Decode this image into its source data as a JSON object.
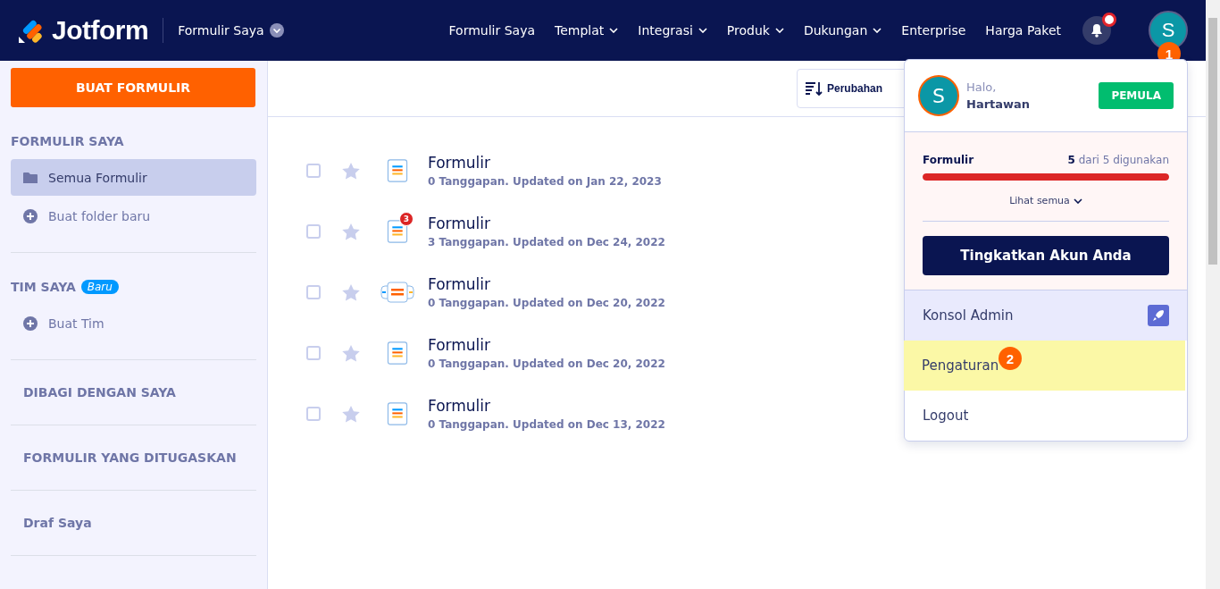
{
  "header": {
    "logo": "Jotform",
    "workspace": "Formulir Saya",
    "nav": [
      {
        "label": "Formulir Saya",
        "dropdown": false
      },
      {
        "label": "Templat",
        "dropdown": true
      },
      {
        "label": "Integrasi",
        "dropdown": true
      },
      {
        "label": "Produk",
        "dropdown": true
      },
      {
        "label": "Dukungan",
        "dropdown": true
      },
      {
        "label": "Enterprise",
        "dropdown": false
      },
      {
        "label": "Harga Paket",
        "dropdown": false
      }
    ],
    "notifications_unread": true,
    "avatar": "S",
    "callout": "1"
  },
  "sidebar": {
    "create_button": "BUAT FORMULIR",
    "sections": [
      {
        "title": "FORMULIR SAYA",
        "items": [
          {
            "label": "Semua Formulir",
            "kind": "folder",
            "selected": true
          },
          {
            "label": "Buat folder baru",
            "kind": "add",
            "selected": false
          }
        ]
      },
      {
        "title": "TIM SAYA",
        "badge": "Baru",
        "items": [
          {
            "label": "Buat Tim",
            "kind": "add",
            "selected": false
          }
        ]
      },
      {
        "link": "DIBAGI DENGAN SAYA"
      },
      {
        "link": "FORMULIR YANG DITUGASKAN"
      },
      {
        "link": "Draf Saya"
      }
    ]
  },
  "toolbar": {
    "sort_button": "Perubahan"
  },
  "forms": [
    {
      "title": "Formulir",
      "meta": "0 Tanggapan. Updated on Jan 22, 2023",
      "kind": "form",
      "checked": false,
      "starred": false
    },
    {
      "title": "Formulir",
      "meta": "3 Tanggapan. Updated on Dec 24, 2022",
      "kind": "form",
      "badge": "3",
      "checked": false,
      "starred": false
    },
    {
      "title": "Formulir",
      "meta": "0 Tanggapan. Updated on Dec 20, 2022",
      "kind": "app",
      "checked": false,
      "starred": false
    },
    {
      "title": "Formulir",
      "meta": "0 Tanggapan. Updated on Dec 20, 2022",
      "kind": "form",
      "checked": false,
      "starred": false
    },
    {
      "title": "Formulir",
      "meta": "0 Tanggapan. Updated on Dec 13, 2022",
      "kind": "form",
      "checked": false,
      "starred": false
    }
  ],
  "account_menu": {
    "avatar": "S",
    "greeting": "Halo,",
    "name": "Hartawan",
    "plan": "PEMULA",
    "usage": {
      "label": "Formulir",
      "used": "5",
      "rest": "dari 5 digunakan",
      "level": 1
    },
    "see_all": "Lihat semua",
    "upgrade_button": "Tingkatkan Akun Anda",
    "items": [
      {
        "label": "Konsol Admin",
        "kind": "admin",
        "highlighted": false
      },
      {
        "label": "Pengaturan",
        "kind": "plain",
        "highlighted": true,
        "callout": "2"
      },
      {
        "label": "Logout",
        "kind": "plain",
        "highlighted": false
      }
    ]
  }
}
